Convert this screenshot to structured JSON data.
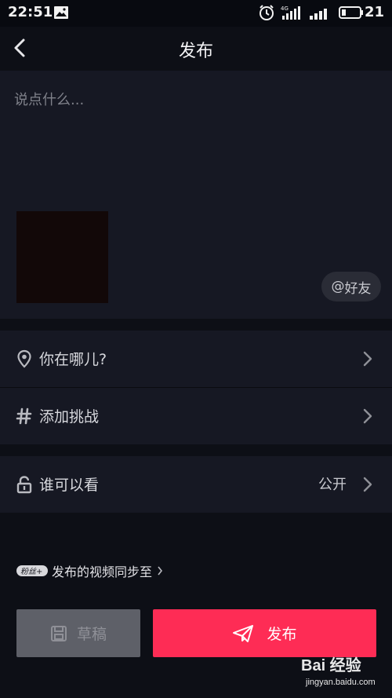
{
  "status_bar": {
    "time": "22:51",
    "network_label": "4G",
    "battery": "21",
    "icons": [
      "image-notification-icon",
      "alarm-icon",
      "signal-4g-icon",
      "signal-icon",
      "battery-icon"
    ]
  },
  "header": {
    "title": "发布",
    "back_icon": "chevron-left-icon"
  },
  "compose": {
    "placeholder": "说点什么...",
    "mention_label": "好友",
    "mention_symbol": "@"
  },
  "options": {
    "location": {
      "label": "你在哪儿?",
      "icon": "location-pin-icon"
    },
    "challenge": {
      "label": "添加挑战",
      "icon": "hashtag-icon"
    },
    "visibility": {
      "label": "谁可以看",
      "value": "公开",
      "icon": "unlock-icon"
    }
  },
  "sync": {
    "badge": "粉丝+",
    "label": "发布的视频同步至"
  },
  "actions": {
    "draft_label": "草稿",
    "publish_label": "发布"
  },
  "watermark": {
    "brand": "Bai  经验",
    "sub": "jingyan.baidu.com"
  },
  "colors": {
    "background": "#0d0f16",
    "panel": "#161823",
    "accent": "#fe2c55",
    "draft_button": "#5e6068"
  }
}
